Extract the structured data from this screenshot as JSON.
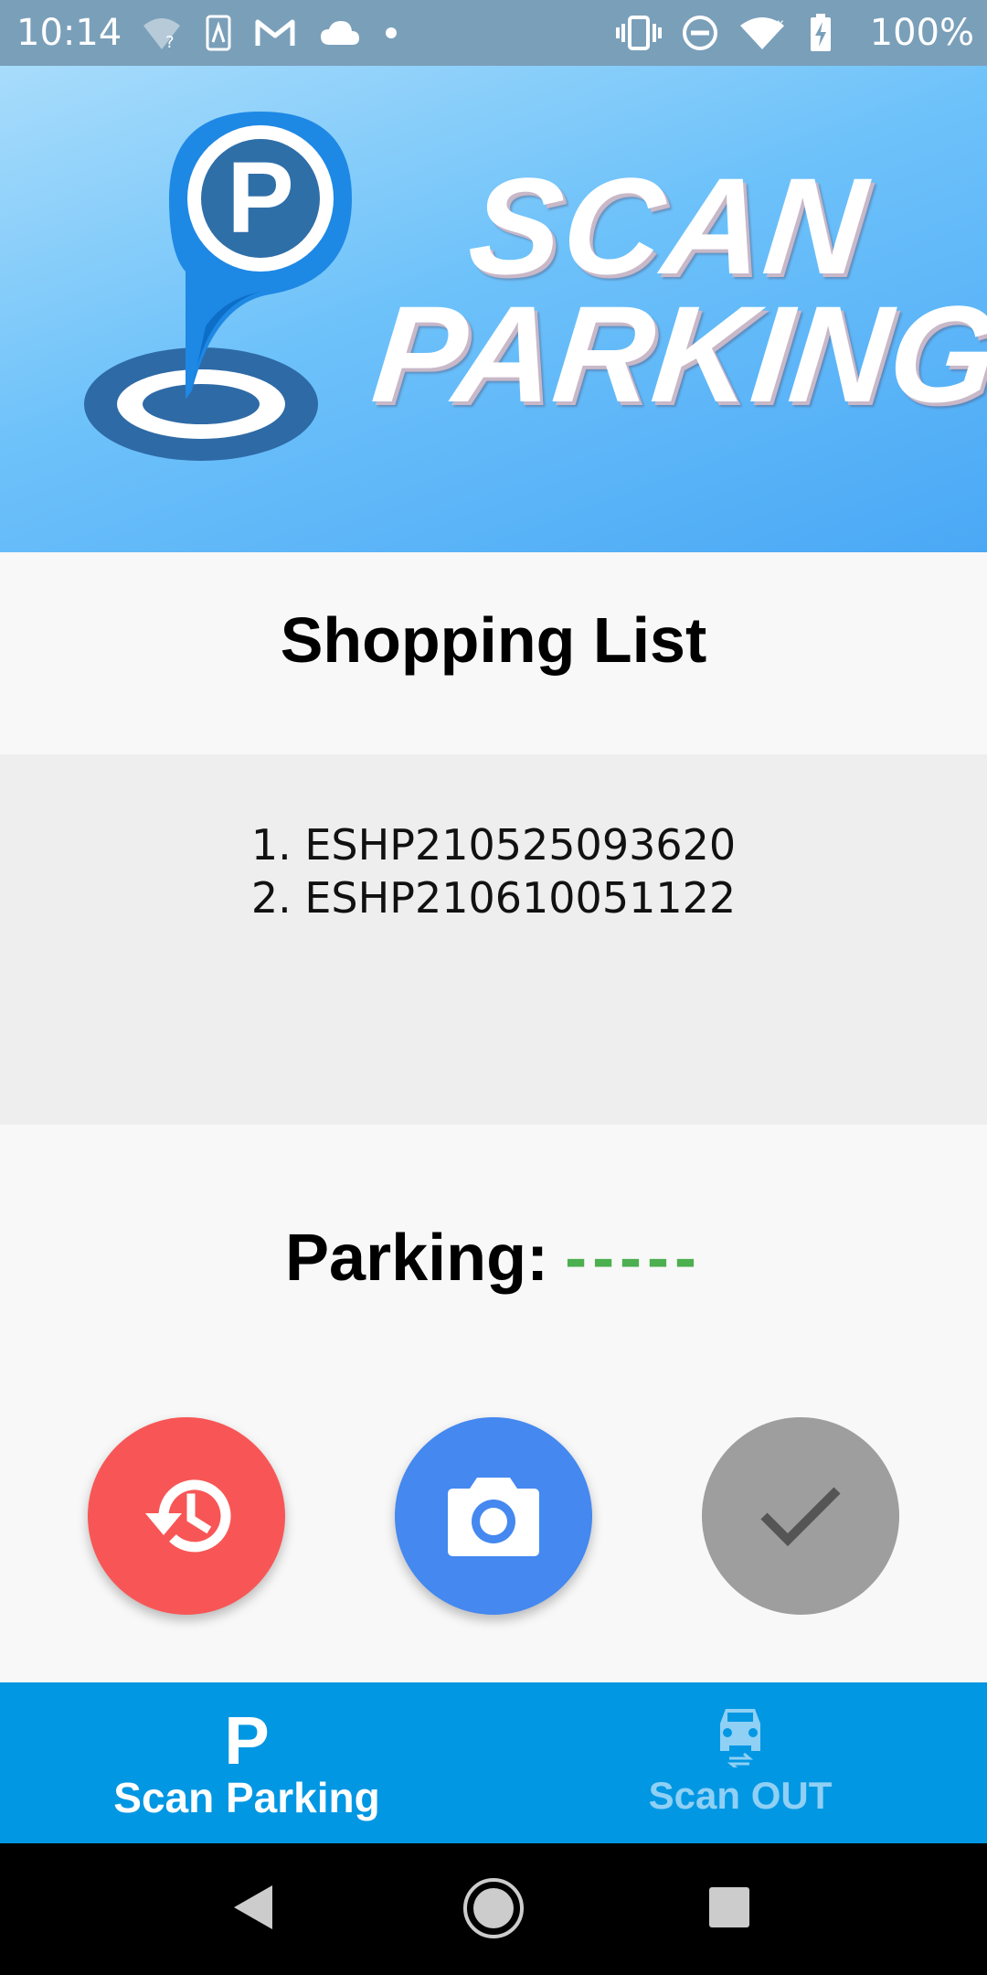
{
  "status_bar": {
    "time": "10:14",
    "battery_text": "100%",
    "left_icons": [
      "wifi-question-icon",
      "sim-card-icon",
      "gmail-icon",
      "cloud-icon",
      "dot-icon"
    ],
    "right_icons": [
      "vibrate-icon",
      "do-not-disturb-icon",
      "wifi-icon",
      "battery-charging-icon"
    ]
  },
  "header": {
    "logo_letter": "P",
    "title_line1": "SCAN",
    "title_line2": "PARKING"
  },
  "shopping_list": {
    "title": "Shopping List",
    "items": [
      "1. ESHP210525093620",
      "2. ESHP210610051122"
    ]
  },
  "parking": {
    "label": "Parking:",
    "value": "-----"
  },
  "actions": {
    "history_icon": "history-icon",
    "camera_icon": "camera-icon",
    "confirm_icon": "check-icon"
  },
  "bottom_nav": {
    "tabs": [
      {
        "label": "Scan Parking",
        "icon": "P",
        "active": true
      },
      {
        "label": "Scan OUT",
        "icon": "car-exit-icon",
        "active": false
      }
    ]
  },
  "colors": {
    "history_button": "#f85656",
    "camera_button": "#4488f0",
    "confirm_button": "#9e9e9e",
    "parking_value": "#4caf50",
    "bottom_nav": "#0297e3"
  }
}
